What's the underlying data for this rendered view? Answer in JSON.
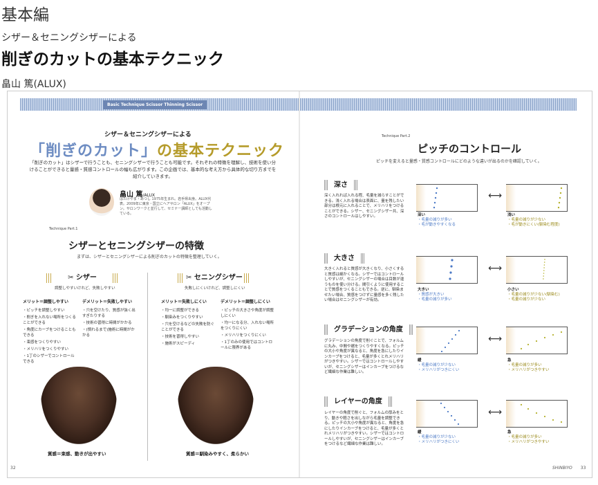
{
  "header": {
    "category": "基本編",
    "subtitle": "シザー＆セニングシザーによる",
    "title": "削ぎのカットの基本テクニック",
    "author": "畠山 篤(ALUX)"
  },
  "spread": {
    "topbar_tag": "Basic Technique  Scissor  Thinning Scissor",
    "left": {
      "kicker": "シザー＆セニングシザーによる",
      "title_quote": "「削ぎのカット」",
      "title_rest": "の基本テクニック",
      "lead": "「削ぎのカット」はシザーで行うことも、セニングシザーで行うことも可能です。それぞれの特徴を理解し、技術を使い分けることができると量感・質感コントロールの幅も広がります。この企画では、基本的な考え方から具体的な切り方までを紹介していきます。",
      "author_name": "畠山 篤",
      "author_tag": "/ALUX",
      "author_bio": "はたけやま・あつし 1975年生まれ。岩手県出身。ALUX代表。2009年に東京・国立にヘアサロン「ALUX」をオープン。サロンワークと並行して、セミナー講師としても活動している。",
      "part_label": "Technique  Part.1",
      "section_title": "シザーとセニングシザーの特徴",
      "section_desc": "まずは、シザーとセニングシザーによる削ぎのカットの特徴を整理していく。",
      "col_left": {
        "head": "✂ シザー",
        "sub": "調整しやすいけれど、失敗しやすい",
        "merit_head": "メリット＝調整しやすい",
        "merits": [
          "・ピッチを調整しやすい",
          "・削ぎを入れない場所をつくることができる",
          "・角度にカーブをつけることもできる",
          "・束感をつくりやすい",
          "・メリハリをつくりやすい",
          "・1丁のシザーでコントロールできる"
        ],
        "demerit_head": "デメリット＝失敗しやすい",
        "demerits": [
          "・穴を空けたり、質感が強く出すぎたりする",
          "・技術の習得に時間がかかる",
          "・(慣れるまで)施術に時間がかかる"
        ],
        "caption": "質感＝束感、動きが出やすい"
      },
      "col_right": {
        "head": "✂ セニングシザー",
        "sub": "失敗しにくいけれど、調整しにくい",
        "merit_head": "メリット＝失敗しにくい",
        "merits": [
          "・均一に調整ができる",
          "・馴染みをつくりやすい",
          "・穴を空けるなどの失敗を防ぐことができる",
          "・技術を習得しやすい",
          "・施術がスピーディ"
        ],
        "demerit_head": "デメリット＝調整しにくい",
        "demerits": [
          "・ピッチの大きさや角度が調整しにくい",
          "・均一になる分、入れない場所をつくりにくい",
          "・メリハリをつくりにくい",
          "・1丁のみの使用ではコントロールに限界がある"
        ],
        "caption": "質感＝馴染みやすく、柔らかい"
      },
      "page_number": "32"
    },
    "right": {
      "part_label": "Technique  Part.2",
      "title": "ピッチのコントロール",
      "desc": "ピッチを変えると量感・質感コントロールにどのような違いが出るのかを確認していく。",
      "rows": [
        {
          "head": "深さ",
          "body": "深く入れれば入れる程、毛量を減らすことができる。浅く入れる場合は表面に、量を残したい部分は根元に入れることで、メリハリをつけることができる。シザー、セニングシザー共、深さのコントロールはしやすい。",
          "left_label": "深い",
          "left_notes": [
            "・毛量の減りが多い",
            "・毛が動きやすくなる"
          ],
          "right_label": "浅い",
          "right_notes": [
            "・毛量の減りが少ない",
            "・毛が動きにくい(馴染む程度)"
          ]
        },
        {
          "head": "大きさ",
          "body": "大きく入れると質感が大きくなり、小さくすると質感は細かくなる。シザーではコントロールしやすいが、セニングシザーの場合は目数が違うものを使い分ける。間引くように使用することで質感をつくることもできる。逆に、馴染ませたい場合、質感をつけずに量感を多く残したい場合はセニングシザーが有効。",
          "left_label": "大きい",
          "left_notes": [
            "・質感が大きい",
            "・毛量の減りが多い"
          ],
          "right_label": "小さい",
          "right_notes": [
            "・毛量の減りが少ない(馴染む)",
            "・毛量の減りが少ない"
          ]
        },
        {
          "head": "グラデーションの角度",
          "body": "グラデーションの角度で削ぐことで、フォルムに丸み、中間や裾をつくりやすくなる。ピッチの大小や角度が異なると、角度を急にしたりインカーブをつけると、毛量が多くとれメリハリがつきやすい。シザーではコントロールしやすいが、セニングシザーはインカーブをつけるなど繊細な作業は難しい。",
          "left_label": "緩",
          "left_notes": [
            "・毛量の減りが少ない",
            "・メリハリがつきにくい"
          ],
          "right_label": "急",
          "right_notes": [
            "・毛量の減りが多い",
            "・メリハリがつきやすい"
          ]
        },
        {
          "head": "レイヤーの角度",
          "body": "レイヤーの角度で削ぐと、フォルムの厚みをとり、動きや軽さを出しながら毛量を調整できる。ピッチの大小や角度が異なると、角度を急にしたりインカーブをつけると、毛量が多くとれメリハリがつきやすい。シザーではコントロールしやすいが、セニングシザーはインカーブをつけるなど繊細な作業は難しい。",
          "left_label": "緩",
          "left_notes": [
            "・毛量の減りが少ない",
            "・メリハリがつきにくい"
          ],
          "right_label": "急",
          "right_notes": [
            "・毛量の減りが多い",
            "・メリハリがつきやすい"
          ]
        }
      ],
      "footer_brand": "SHINBIYO",
      "page_number": "33"
    },
    "colors": {
      "accent_blue": "#6d8cc2",
      "accent_gold": "#b59b2a",
      "dot_blue": "#4a78c5",
      "dot_yellow": "#b4b02a"
    }
  }
}
